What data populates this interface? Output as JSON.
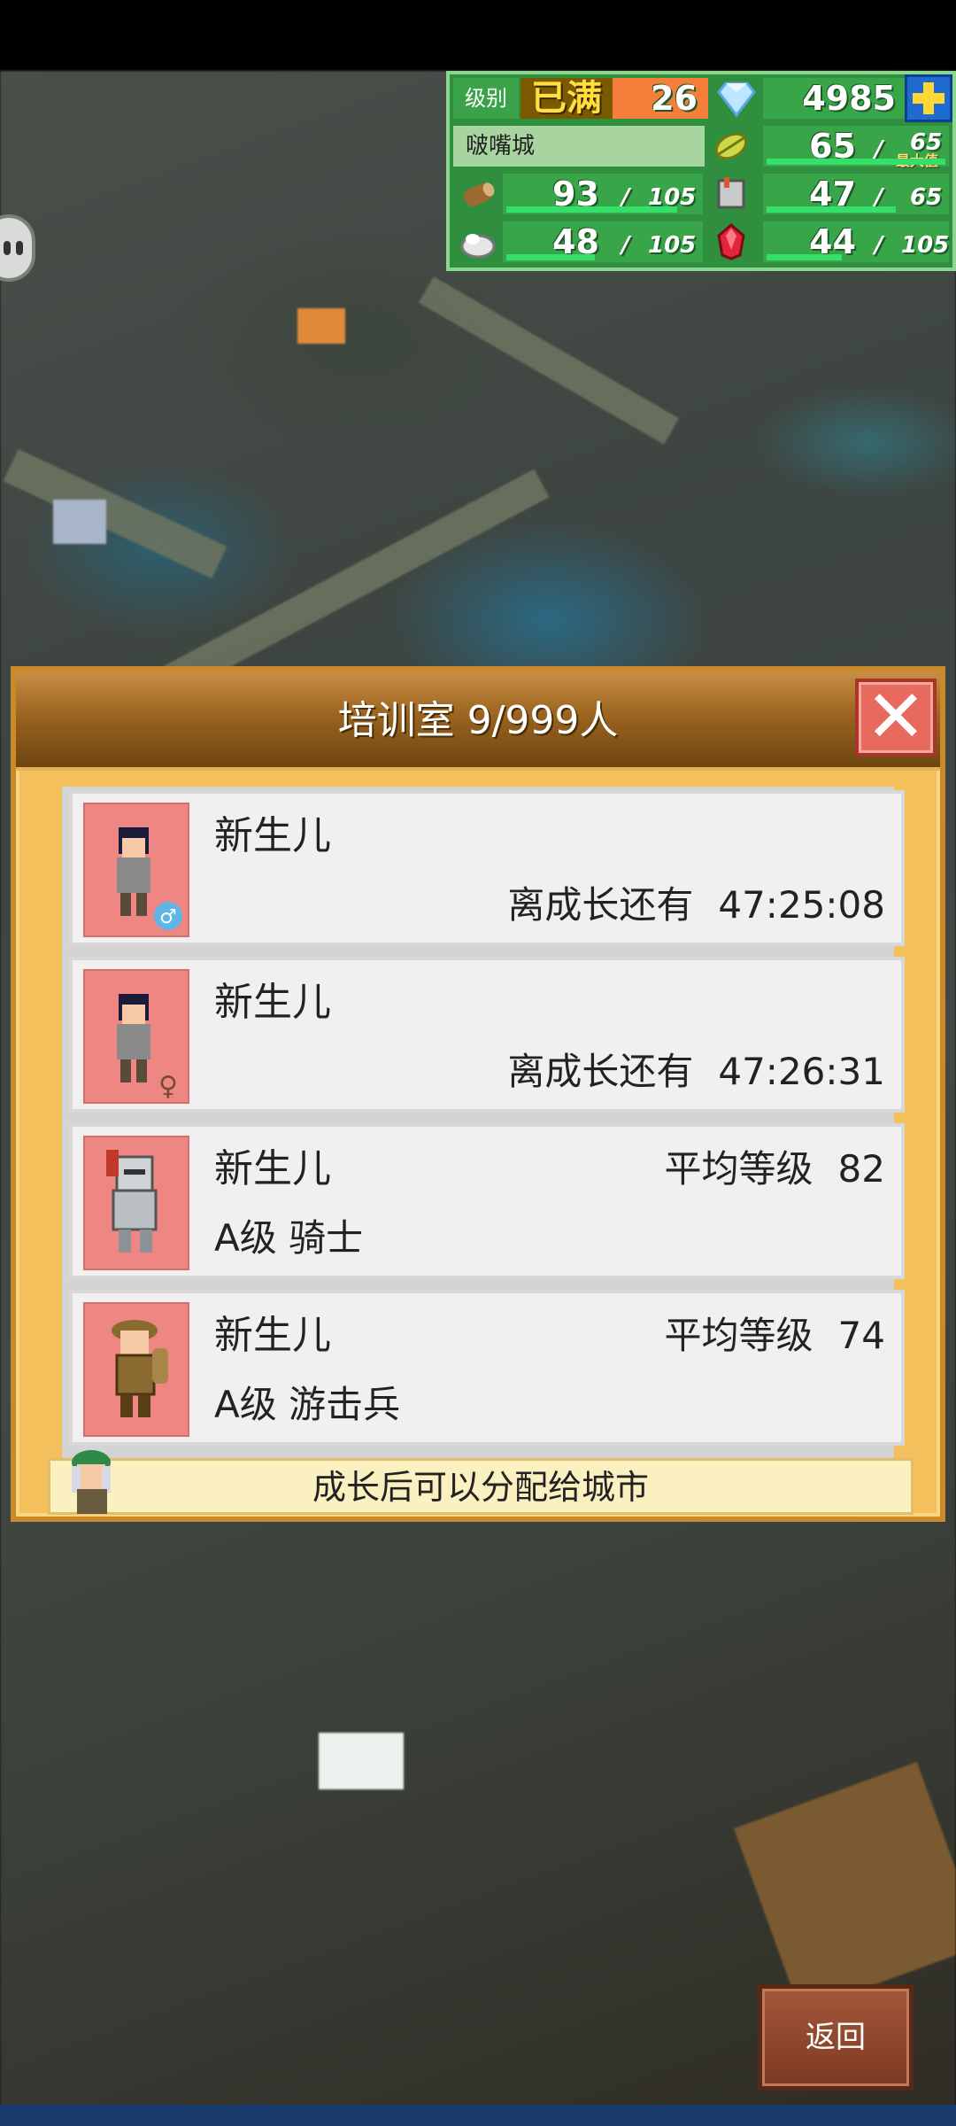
{
  "hud": {
    "level_label": "级别",
    "level_status": "已满",
    "level_value": "26",
    "gems": "4985",
    "city_name": "啵嘴城",
    "food": {
      "current": "65",
      "max": "65",
      "max_tag": "最大值",
      "fill": 1.0
    },
    "wood": {
      "current": "93",
      "max": "105",
      "fill": 0.886
    },
    "weapon": {
      "current": "47",
      "max": "65",
      "fill": 0.723
    },
    "ore": {
      "current": "48",
      "max": "105",
      "fill": 0.457
    },
    "crystal": {
      "current": "44",
      "max": "105",
      "fill": 0.419
    },
    "slash": "/",
    "colors": {
      "hud_bg": "#2f8f3e",
      "bar": "#34e06a",
      "level_accent": "#f57f3a"
    }
  },
  "panel": {
    "title": "培训室 9/999人",
    "close_label": "✕",
    "entries": [
      {
        "name": "新生儿",
        "countdown_label": "离成长还有",
        "countdown": "47:25:08",
        "gender": "male",
        "portrait": "boy-sprite"
      },
      {
        "name": "新生儿",
        "countdown_label": "离成长还有",
        "countdown": "47:26:31",
        "gender": "female",
        "portrait": "boy-sprite"
      },
      {
        "name": "新生儿",
        "avg_label": "平均等级",
        "avg_level": "82",
        "class": "A级 骑士",
        "portrait": "knight-sprite"
      },
      {
        "name": "新生儿",
        "avg_label": "平均等级",
        "avg_level": "74",
        "class": "A级 游击兵",
        "portrait": "ranger-sprite"
      }
    ],
    "hint": "成长后可以分配给城市"
  },
  "back_button": {
    "label": "返回"
  }
}
